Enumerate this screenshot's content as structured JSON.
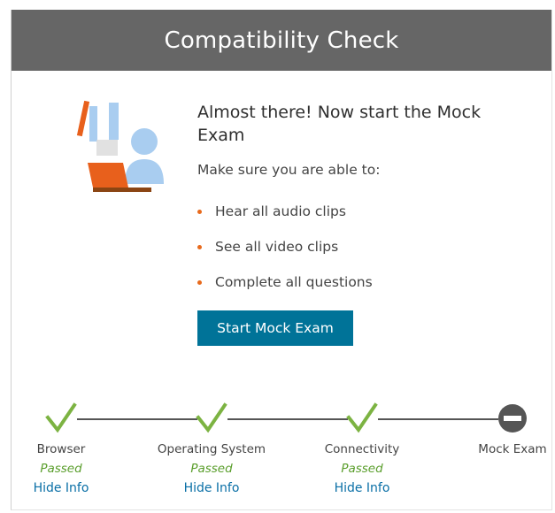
{
  "header": {
    "title": "Compatibility Check"
  },
  "main": {
    "heading": "Almost there! Now start the Mock Exam",
    "subtext": "Make sure you are able to:",
    "bullets": [
      {
        "label": "Hear all audio clips"
      },
      {
        "label": "See all video clips"
      },
      {
        "label": "Complete all questions"
      }
    ],
    "start_button": "Start Mock Exam"
  },
  "steps": [
    {
      "name": "Browser",
      "status": "Passed",
      "link": "Hide Info",
      "icon": "check-icon"
    },
    {
      "name": "Operating System",
      "status": "Passed",
      "link": "Hide Info",
      "icon": "check-icon"
    },
    {
      "name": "Connectivity",
      "status": "Passed",
      "link": "Hide Info",
      "icon": "check-icon"
    },
    {
      "name": "Mock Exam",
      "icon": "minus-circle-icon"
    }
  ],
  "colors": {
    "header_bg": "#666666",
    "button_bg": "#007398",
    "bullet": "#e86a1c",
    "passed": "#5a9e2c",
    "link": "#0a6fa6",
    "check": "#7cb342",
    "pending": "#555555"
  }
}
